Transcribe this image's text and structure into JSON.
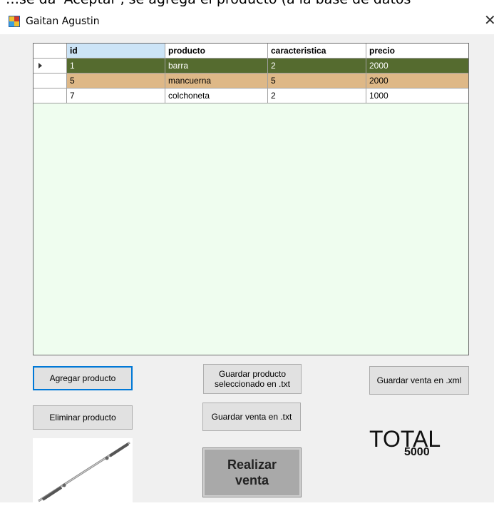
{
  "top_clip_text": "…se da 'Aceptar', se agrega el producto (a la base de datos",
  "window": {
    "title": "Gaitan Agustin",
    "close_glyph": "✕"
  },
  "grid": {
    "columns": [
      "id",
      "producto",
      "caracteristica",
      "precio"
    ],
    "rows": [
      {
        "id": "1",
        "producto": "barra",
        "caracteristica": "2",
        "precio": "2000",
        "selected": true
      },
      {
        "id": "5",
        "producto": "mancuerna",
        "caracteristica": "5",
        "precio": "2000"
      },
      {
        "id": "7",
        "producto": "colchoneta",
        "caracteristica": "2",
        "precio": "1000"
      }
    ],
    "colors": {
      "selected_row": "#556b2f",
      "highlight_row": "#deb887",
      "background": "#effdef"
    }
  },
  "buttons": {
    "agregar": "Agregar producto",
    "eliminar": "Eliminar producto",
    "guardar_seleccionado_l1": "Guardar producto",
    "guardar_seleccionado_l2": "seleccionado en .txt",
    "guardar_txt": "Guardar venta en .txt",
    "guardar_xml": "Guardar venta en .xml",
    "realizar_l1": "Realizar",
    "realizar_l2": "venta"
  },
  "total": {
    "label": "TOTAL",
    "value": "5000"
  },
  "icons": {
    "app": "app-icon",
    "row_indicator": "row-pointer-icon",
    "product": "barbell-image"
  }
}
